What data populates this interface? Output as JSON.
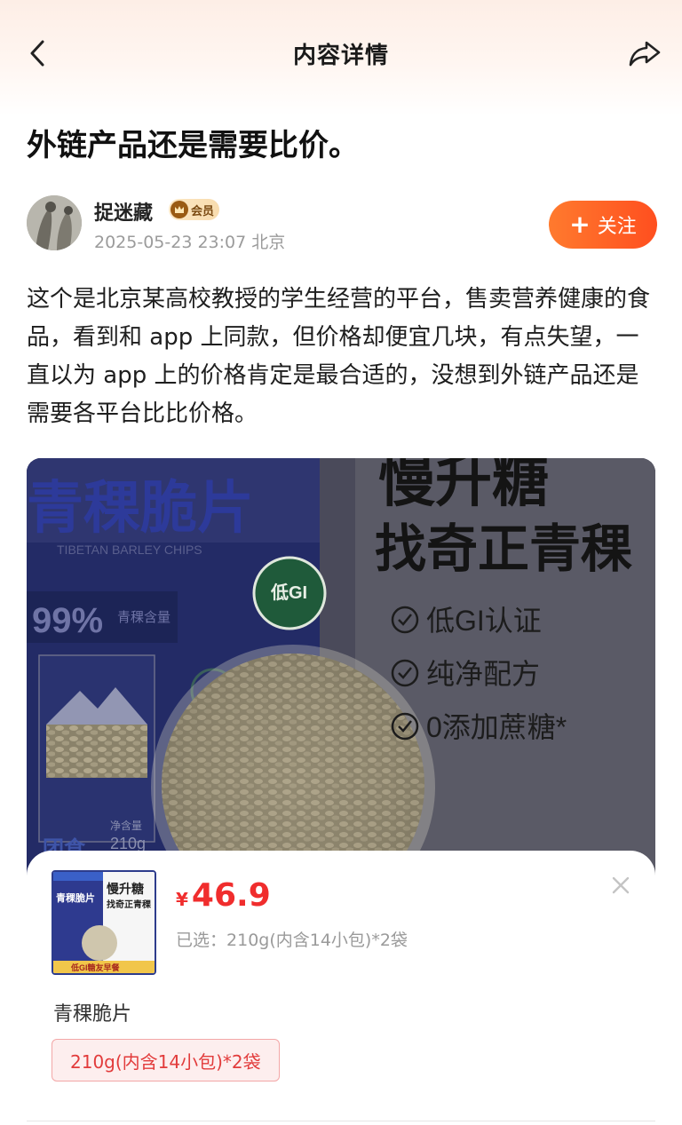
{
  "nav": {
    "title": "内容详情"
  },
  "post": {
    "title": "外链产品还是需要比价。",
    "author": {
      "name": "捉迷藏",
      "badge": "会员",
      "date": "2025-05-23 23:07",
      "location": "北京",
      "follow_label": "关注"
    },
    "body": "这个是北京某高校教授的学生经营的平台，售卖营养健康的食品，看到和 app 上同款，但价格却便宜几块，有点失望，一直以为 app 上的价格肯定是最合适的，没想到外链产品还是需要各平台比比价格。"
  },
  "media": {
    "package_title": "青稞脆片",
    "package_sub": "TIBETAN BARLEY CHIPS",
    "percent": "99%",
    "percent_label": "青稞含量",
    "gi_badge": "低GI",
    "net_weight_label": "净含量",
    "net_weight": "210g",
    "headline_1": "慢升糖",
    "headline_2": "找奇正青稞",
    "features": [
      "低GI认证",
      "纯净配方",
      "0添加蔗糖*"
    ]
  },
  "product": {
    "currency": "¥",
    "price": "46.9",
    "selected_label": "已选：",
    "selected_value": "210g(内含14小包)*2袋",
    "name": "青稞脆片",
    "spec": "210g(内含14小包)*2袋",
    "thumb_headline": "慢升糖",
    "thumb_sub": "找奇正青稞",
    "thumb_title": "青稞脆片",
    "thumb_footer": "低GI糖友早餐"
  },
  "colors": {
    "accent": "#ff5a22",
    "price": "#f02d2d",
    "package_blue": "#2e3a8f"
  }
}
